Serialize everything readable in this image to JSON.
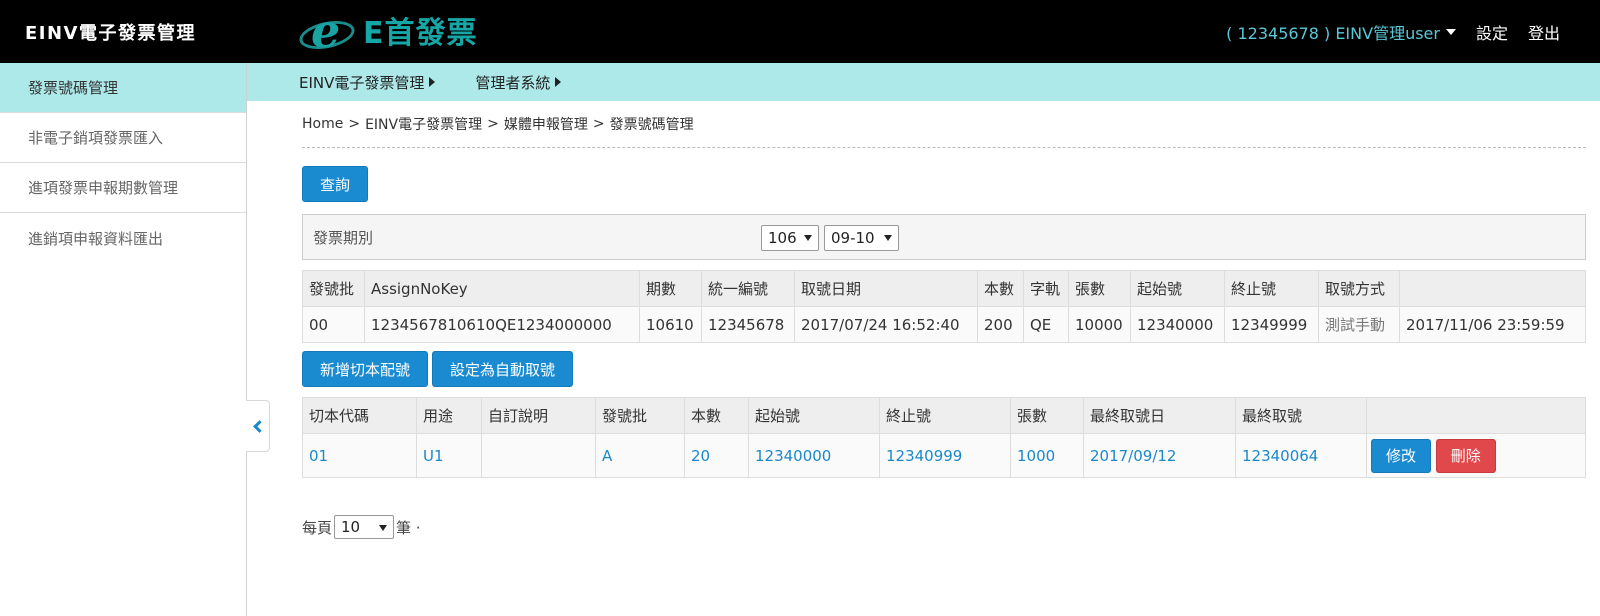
{
  "header": {
    "brand": "EINV電子發票管理",
    "logo_text": "E首發票",
    "user_menu": "( 12345678 ) EINV管理user",
    "settings": "設定",
    "logout": "登出"
  },
  "sidebar": {
    "items": [
      {
        "label": "發票號碼管理"
      },
      {
        "label": "非電子銷項發票匯入"
      },
      {
        "label": "進項發票申報期數管理"
      },
      {
        "label": "進銷項申報資料匯出"
      }
    ]
  },
  "subnav": {
    "items": [
      {
        "label": "EINV電子發票管理"
      },
      {
        "label": "管理者系統"
      }
    ]
  },
  "breadcrumb": [
    "Home",
    "EINV電子發票管理",
    "媒體申報管理",
    "發票號碼管理"
  ],
  "breadcrumb_sep": ">",
  "query_button": "查詢",
  "filter": {
    "label": "發票期別",
    "year": "106",
    "period": "09-10"
  },
  "assign_table": {
    "headers": [
      "發號批",
      "AssignNoKey",
      "期數",
      "統一編號",
      "取號日期",
      "本數",
      "字軌",
      "張數",
      "起始號",
      "終止號",
      "取號方式",
      ""
    ],
    "row": [
      "00",
      "1234567810610QE1234000000",
      "10610",
      "12345678",
      "2017/07/24 16:52:40",
      "200",
      "QE",
      "10000",
      "12340000",
      "12349999",
      "測試手動",
      "2017/11/06 23:59:59"
    ]
  },
  "actions": {
    "add_button": "新增切本配號",
    "auto_button": "設定為自動取號"
  },
  "split_table": {
    "headers": [
      "切本代碼",
      "用途",
      "自訂說明",
      "發號批",
      "本數",
      "起始號",
      "終止號",
      "張數",
      "最終取號日",
      "最終取號",
      ""
    ],
    "row": [
      "01",
      "U1",
      "",
      "A",
      "20",
      "12340000",
      "12340999",
      "1000",
      "2017/09/12",
      "12340064"
    ],
    "edit_button": "修改",
    "delete_button": "刪除"
  },
  "pager": {
    "prefix": "每頁",
    "page_size": "10",
    "suffix": "筆 ·"
  }
}
